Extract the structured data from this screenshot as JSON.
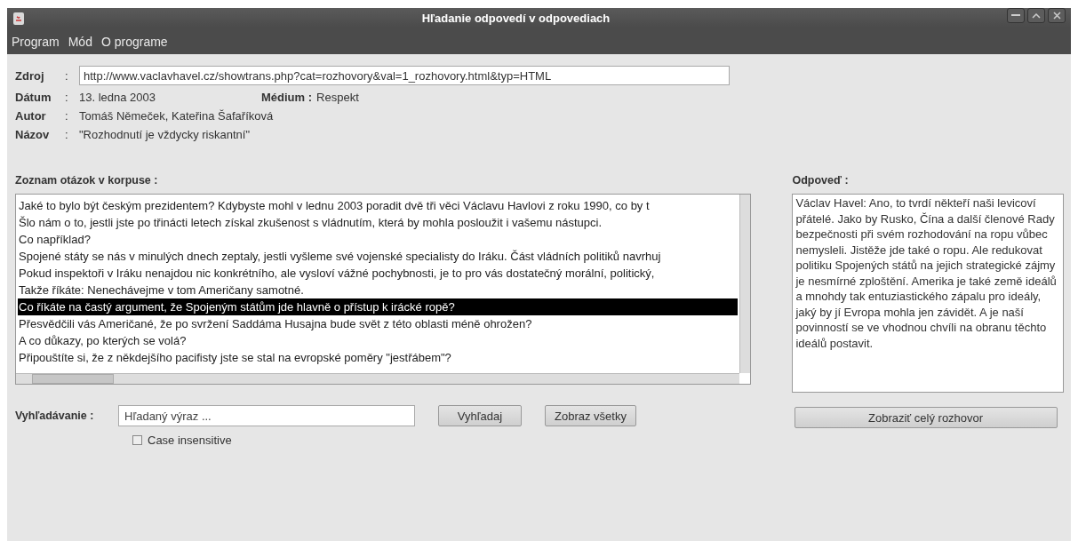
{
  "window": {
    "title": "Hľadanie odpovedí v odpovediach"
  },
  "menu": [
    "Program",
    "Mód",
    "O programe"
  ],
  "meta": [
    {
      "label": "Zdroj",
      "colon": ":",
      "kind": "field",
      "value": "http://www.vaclavhavel.cz/showtrans.php?cat=rozhovory&val=1_rozhovory.html&typ=HTML"
    },
    {
      "label": "Dátum",
      "colon": ":",
      "kind": "text",
      "value": "13. ledna 2003",
      "extra_label": "Médium :",
      "extra_value": "Respekt"
    },
    {
      "label": "Autor",
      "colon": ":",
      "kind": "text",
      "value": "Tomáš Němeček, Kateřina Šafaříková"
    },
    {
      "label": "Názov",
      "colon": ":",
      "kind": "text",
      "value": "\"Rozhodnutí je vždycky riskantní\""
    }
  ],
  "questions": {
    "title": "Zoznam otázok v korpuse :",
    "items": [
      {
        "text": "Jaké to bylo být českým prezidentem? Kdybyste mohl v lednu 2003 poradit dvě tři věci Václavu Havlovi z roku 1990, co by t",
        "selected": false
      },
      {
        "text": "Šlo nám o to, jestli jste po třinácti letech získal zkušenost s vládnutím, která by mohla posloužit i vašemu nástupci.",
        "selected": false
      },
      {
        "text": "Co například?",
        "selected": false
      },
      {
        "text": "Spojené státy se nás v minulých dnech zeptaly, jestli vyšleme své vojenské specialisty do Iráku. Část vládních politiků navrhuj",
        "selected": false
      },
      {
        "text": "Pokud inspektoři v Iráku nenajdou nic konkrétního, ale vysloví vážné pochybnosti, je to pro vás dostatečný morální, politický,",
        "selected": false
      },
      {
        "text": "Takže říkáte: Nenechávejme v tom Američany samotné.",
        "selected": false
      },
      {
        "text": "Co říkáte na častý argument, že Spojeným státům jde hlavně o přístup k irácké ropě?",
        "selected": true
      },
      {
        "text": "Přesvědčili vás Američané, že po svržení Saddáma Husajna bude svět z této oblasti méně ohrožen?",
        "selected": false
      },
      {
        "text": "A co důkazy, po kterých se volá?",
        "selected": false
      },
      {
        "text": "Připouštíte si, že z někdejšího pacifisty jste se stal na evropské poměry \"jestřábem\"?",
        "selected": false
      }
    ]
  },
  "answer": {
    "title": "Odpoveď :",
    "text": "Václav Havel: Ano, to tvrdí někteří naši levicoví přátelé. Jako by Rusko, Čína a další členové Rady bezpečnosti při svém rozhodování na ropu vůbec nemysleli. Jistěže jde také o ropu. Ale redukovat politiku Spojených států na jejich strategické zájmy je nesmírné zploštění. Amerika je také země ideálů a mnohdy tak entuziastického zápalu pro ideály, jaký by jí Evropa mohla jen závidět. A je naší povinností se ve vhodnou chvíli na obranu těchto ideálů postavit.",
    "button": "Zobraziť celý rozhovor"
  },
  "search": {
    "label": "Vyhľadávanie :",
    "placeholder": "Hľadaný výraz ...",
    "buttons": [
      "Vyhľadaj",
      "Zobraz všetky"
    ],
    "case_insensitive": {
      "label": "Case insensitive",
      "checked": false
    }
  }
}
